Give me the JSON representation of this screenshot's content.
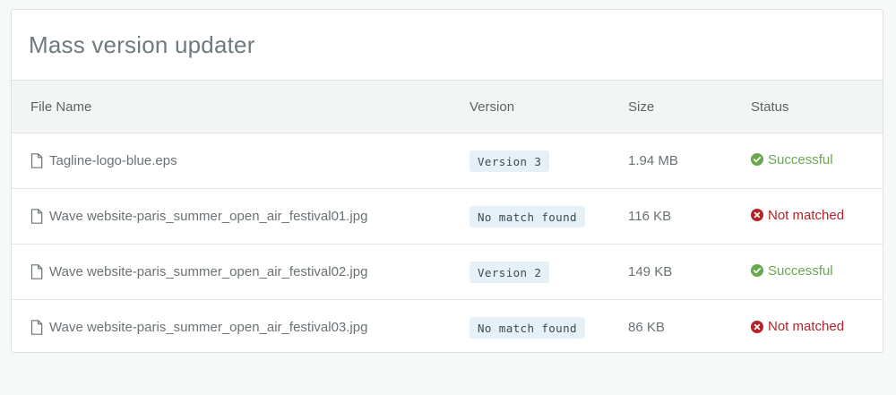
{
  "card": {
    "title": "Mass version updater"
  },
  "table": {
    "columns": [
      "File Name",
      "Version",
      "Size",
      "Status"
    ],
    "rows": [
      {
        "file_name": "Tagline-logo-blue.eps",
        "version": "Version 3",
        "size": "1.94 MB",
        "status": "Successful",
        "status_kind": "success"
      },
      {
        "file_name": "Wave website-paris_summer_open_air_festival01.jpg",
        "version": "No match found",
        "size": "116 KB",
        "status": "Not matched",
        "status_kind": "error"
      },
      {
        "file_name": "Wave website-paris_summer_open_air_festival02.jpg",
        "version": "Version 2",
        "size": "149 KB",
        "status": "Successful",
        "status_kind": "success"
      },
      {
        "file_name": "Wave website-paris_summer_open_air_festival03.jpg",
        "version": "No match found",
        "size": "86 KB",
        "status": "Not matched",
        "status_kind": "error"
      }
    ]
  },
  "colors": {
    "success": "#6aa84f",
    "error": "#b3242a",
    "badge_bg": "#e5f1f7"
  },
  "icons": {
    "file": "document-icon",
    "success": "check-circle-icon",
    "error": "x-circle-icon"
  }
}
